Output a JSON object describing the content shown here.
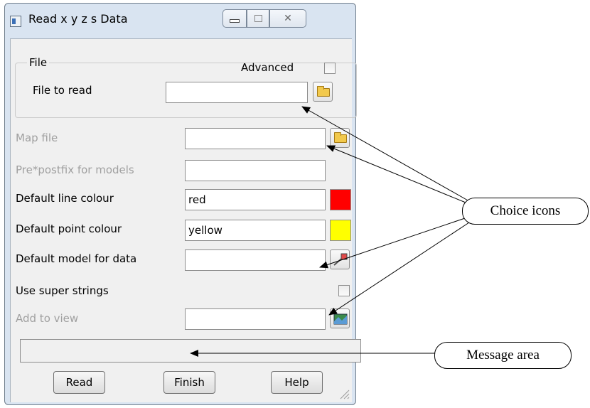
{
  "window": {
    "title": "Read x y z s Data",
    "min_label": "—",
    "max_label": "□",
    "close_label": "✕"
  },
  "file_group": {
    "label": "File",
    "advanced_label": "Advanced",
    "advanced_checked": false,
    "file_to_read_label": "File to read",
    "file_to_read_value": ""
  },
  "fields": {
    "map_file_label": "Map file",
    "map_file_value": "",
    "prepostfix_label": "Pre*postfix for models",
    "prepostfix_value": "",
    "line_colour_label": "Default line colour",
    "line_colour_value": "red",
    "line_colour_swatch": "#ff0000",
    "point_colour_label": "Default point colour",
    "point_colour_value": "yellow",
    "point_colour_swatch": "#ffff00",
    "model_label": "Default model for data",
    "model_value": "",
    "super_strings_label": "Use super strings",
    "super_strings_checked": false,
    "add_to_view_label": "Add to view",
    "add_to_view_value": ""
  },
  "message_area": "",
  "buttons": {
    "read": "Read",
    "finish": "Finish",
    "help": "Help"
  },
  "callouts": {
    "choice_icons": "Choice icons",
    "message_area": "Message area"
  },
  "icons": [
    "app-icon",
    "folder-icon",
    "model-icon",
    "view-icon",
    "resize-grip-icon"
  ]
}
